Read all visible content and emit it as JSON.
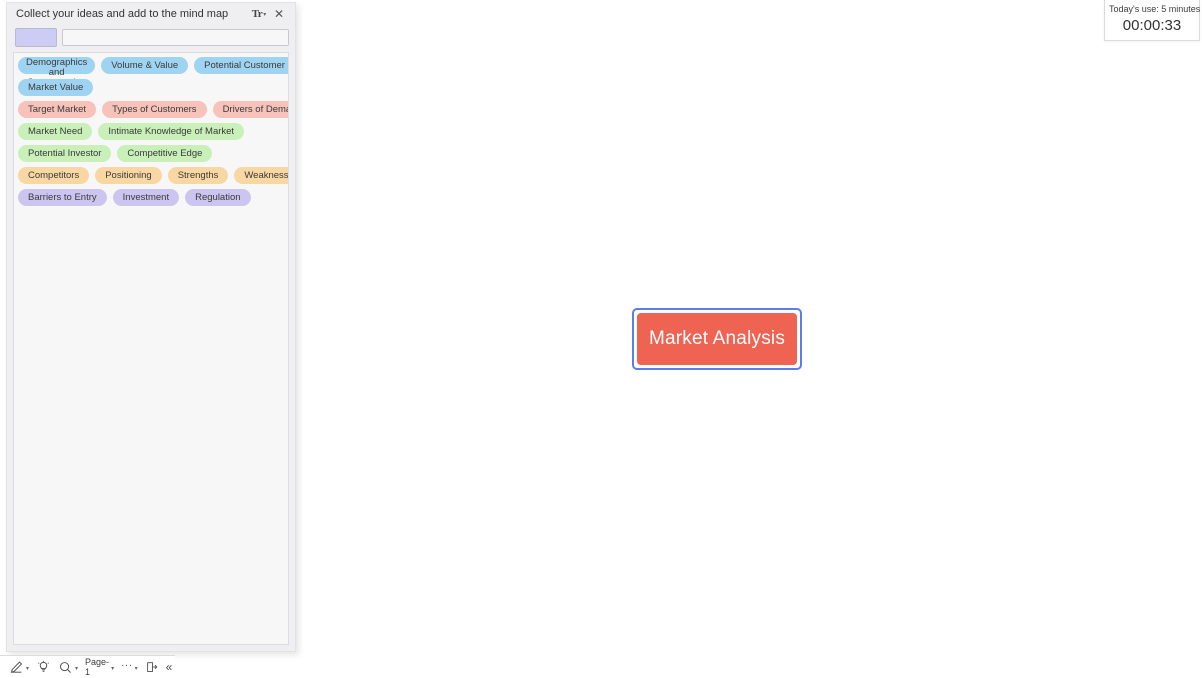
{
  "center_node": {
    "label": "Market Analysis",
    "fill_color": "#ee6352",
    "selection_border_color": "#5b7fe8",
    "text_color": "#ffffff"
  },
  "timer": {
    "usage_label": "Today's use: 5 minutes",
    "elapsed": "00:00:33"
  },
  "idea_panel": {
    "title": "Collect your ideas and add to the mind map",
    "font_icon": "text-format-icon",
    "font_icon_glyph": "Tr",
    "close_icon": "close-icon",
    "close_glyph": "✕",
    "color_swatch": "#ccccf5",
    "input_value": "",
    "input_placeholder": "",
    "tag_rows": [
      {
        "tags": [
          {
            "label": "Demographics and Segmentation",
            "color": "#9ed4f2",
            "color_name": "c-blue",
            "wrap": true
          },
          {
            "label": "Volume & Value",
            "color": "#9ed4f2",
            "color_name": "c-blue",
            "wrap": false
          },
          {
            "label": "Potential Customer",
            "color": "#9ed4f2",
            "color_name": "c-blue",
            "wrap": false
          }
        ]
      },
      {
        "tags": [
          {
            "label": "Market Value",
            "color": "#9ed4f2",
            "color_name": "c-blue",
            "wrap": false
          }
        ]
      },
      {
        "tags": [
          {
            "label": "Target Market",
            "color": "#f7c2b9",
            "color_name": "c-pink",
            "wrap": false
          },
          {
            "label": "Types of Customers",
            "color": "#f7c2b9",
            "color_name": "c-pink",
            "wrap": false
          },
          {
            "label": "Drivers of Demand",
            "color": "#f7c2b9",
            "color_name": "c-pink",
            "wrap": false
          }
        ]
      },
      {
        "tags": [
          {
            "label": "Market Need",
            "color": "#c8f0b8",
            "color_name": "c-green",
            "wrap": false
          },
          {
            "label": "Intimate Knowledge of Market",
            "color": "#c8f0b8",
            "color_name": "c-green",
            "wrap": false
          }
        ]
      },
      {
        "tags": [
          {
            "label": "Potential Investor",
            "color": "#c8f0b8",
            "color_name": "c-green",
            "wrap": false
          },
          {
            "label": "Competitive Edge",
            "color": "#c8f0b8",
            "color_name": "c-green",
            "wrap": false
          }
        ]
      },
      {
        "tags": [
          {
            "label": "Competitors",
            "color": "#f9d7a3",
            "color_name": "c-orange",
            "wrap": false
          },
          {
            "label": "Positioning",
            "color": "#f9d7a3",
            "color_name": "c-orange",
            "wrap": false
          },
          {
            "label": "Strengths",
            "color": "#f9d7a3",
            "color_name": "c-orange",
            "wrap": false
          },
          {
            "label": "Weaknesses",
            "color": "#f9d7a3",
            "color_name": "c-orange",
            "wrap": false
          }
        ]
      },
      {
        "tags": [
          {
            "label": "Barriers to Entry",
            "color": "#cbc5f0",
            "color_name": "c-purple",
            "wrap": false
          },
          {
            "label": "Investment",
            "color": "#cbc5f0",
            "color_name": "c-purple",
            "wrap": false
          },
          {
            "label": "Regulation",
            "color": "#cbc5f0",
            "color_name": "c-purple",
            "wrap": false
          }
        ]
      }
    ]
  },
  "bottom_toolbar": {
    "pen_icon": "pen-icon",
    "bulb_icon": "lightbulb-icon",
    "zoom_icon": "magnifier-icon",
    "page_label": "Page-1",
    "more_label": "···",
    "export_icon": "export-panel-icon",
    "collapse_icon": "collapse-left-icon",
    "collapse_glyph": "«",
    "caret": "▾"
  }
}
